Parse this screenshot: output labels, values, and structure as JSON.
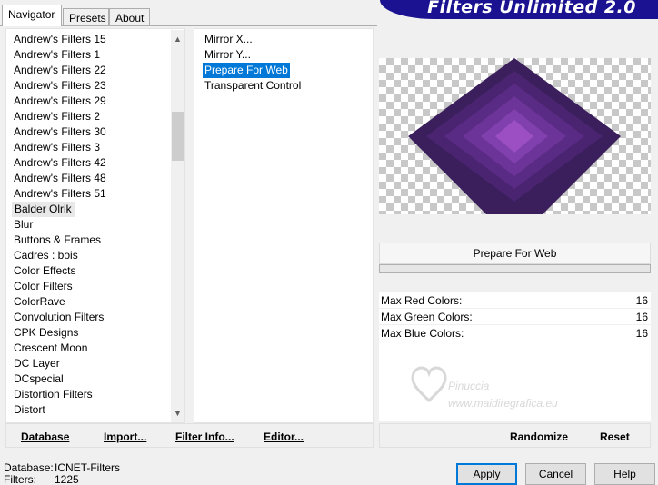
{
  "tabs": [
    {
      "label": "Navigator",
      "active": true
    },
    {
      "label": "Presets",
      "active": false
    },
    {
      "label": "About",
      "active": false
    }
  ],
  "banner": {
    "title": "Filters Unlimited 2.0"
  },
  "categories": [
    "Andrew's Filters 15",
    "Andrew's Filters 1",
    "Andrew's Filters 22",
    "Andrew's Filters 23",
    "Andrew's Filters 29",
    "Andrew's Filters 2",
    "Andrew's Filters 30",
    "Andrew's Filters 3",
    "Andrew's Filters 42",
    "Andrew's Filters 48",
    "Andrew's Filters 51",
    "Balder Olrik",
    "Blur",
    "Buttons & Frames",
    "Cadres : bois",
    "Color Effects",
    "Color Filters",
    "ColorRave",
    "Convolution Filters",
    "CPK Designs",
    "Crescent Moon",
    "DC Layer",
    "DCspecial",
    "Distortion Filters",
    "Distort"
  ],
  "selected_category": "Balder Olrik",
  "filters": [
    "Mirror X...",
    "Mirror Y...",
    "Prepare For Web",
    "Transparent Control"
  ],
  "selected_filter": "Prepare For Web",
  "filter_name": "Prepare For Web",
  "params": [
    {
      "label": "Max Red Colors:",
      "value": "16"
    },
    {
      "label": "Max Green Colors:",
      "value": "16"
    },
    {
      "label": "Max Blue Colors:",
      "value": "16"
    }
  ],
  "watermark": {
    "line1": "Pinuccia",
    "line2": "www.maidiregrafica.eu"
  },
  "bottom_buttons": {
    "database": "Database",
    "import": "Import...",
    "filter_info": "Filter Info...",
    "editor": "Editor...",
    "randomize": "Randomize",
    "reset": "Reset"
  },
  "status": {
    "database_label": "Database:",
    "database_value": "ICNET-Filters",
    "filters_label": "Filters:",
    "filters_value": "1225"
  },
  "dialog_buttons": {
    "apply": "Apply",
    "cancel": "Cancel",
    "help": "Help"
  },
  "colors": {
    "selection": "#0078d7",
    "banner": "#1a1290",
    "diamond_outer": "#3a1f5c",
    "diamond_inner": "#9b4fc2"
  }
}
